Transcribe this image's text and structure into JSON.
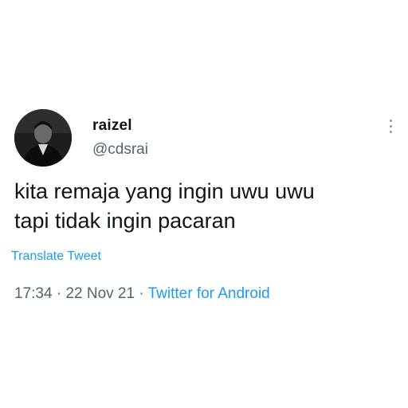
{
  "tweet": {
    "display_name": "raizel",
    "handle": "@cdsrai",
    "text_lines": [
      "kita remaja yang ingin uwu uwu",
      "tapi tidak ingin pacaran"
    ],
    "translate_label": "Translate Tweet",
    "time": "17:34",
    "separator": " · ",
    "date": "22 Nov 21",
    "source": "Twitter for Android"
  },
  "icons": {
    "avatar": "profile-photo",
    "more": "more-options-vertical-dots-icon"
  },
  "colors": {
    "background": "#ffffff",
    "text_primary": "#0f1419",
    "text_secondary": "#536471",
    "link": "#1d9bf0"
  }
}
